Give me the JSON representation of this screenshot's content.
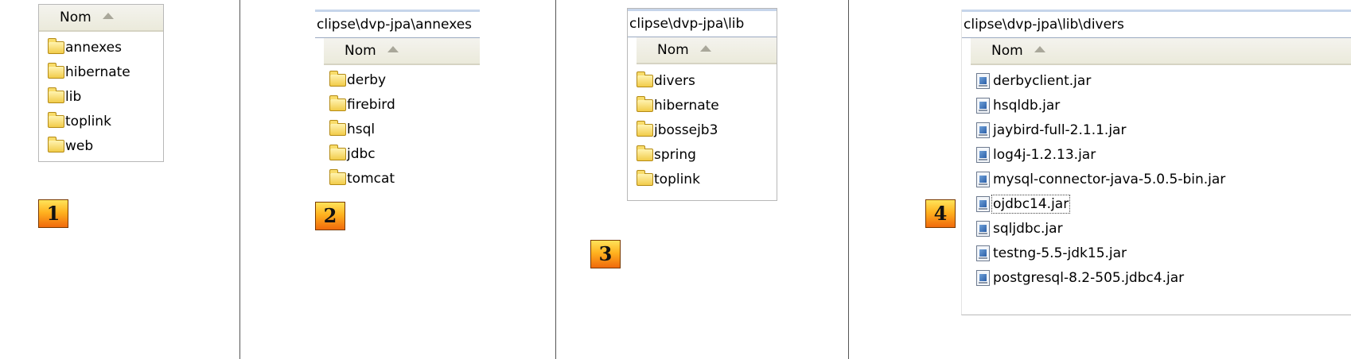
{
  "column_header": "Nom",
  "panel1": {
    "badge": "1",
    "folders": [
      "annexes",
      "hibernate",
      "lib",
      "toplink",
      "web"
    ]
  },
  "panel2": {
    "address": "clipse\\dvp-jpa\\annexes",
    "badge": "2",
    "folders": [
      "derby",
      "firebird",
      "hsql",
      "jdbc",
      "tomcat"
    ]
  },
  "panel3": {
    "address": "clipse\\dvp-jpa\\lib",
    "badge": "3",
    "folders": [
      "divers",
      "hibernate",
      "jbossejb3",
      "spring",
      "toplink"
    ]
  },
  "panel4": {
    "address": "clipse\\dvp-jpa\\lib\\divers",
    "badge": "4",
    "files": [
      "derbyclient.jar",
      "hsqldb.jar",
      "jaybird-full-2.1.1.jar",
      "log4j-1.2.13.jar",
      "mysql-connector-java-5.0.5-bin.jar",
      "ojdbc14.jar",
      "sqljdbc.jar",
      "testng-5.5-jdk15.jar",
      "postgresql-8.2-505.jdbc4.jar"
    ]
  },
  "icons": {
    "folder": "folder-icon",
    "file": "jar-file-icon",
    "sort": "sort-ascending-icon"
  }
}
